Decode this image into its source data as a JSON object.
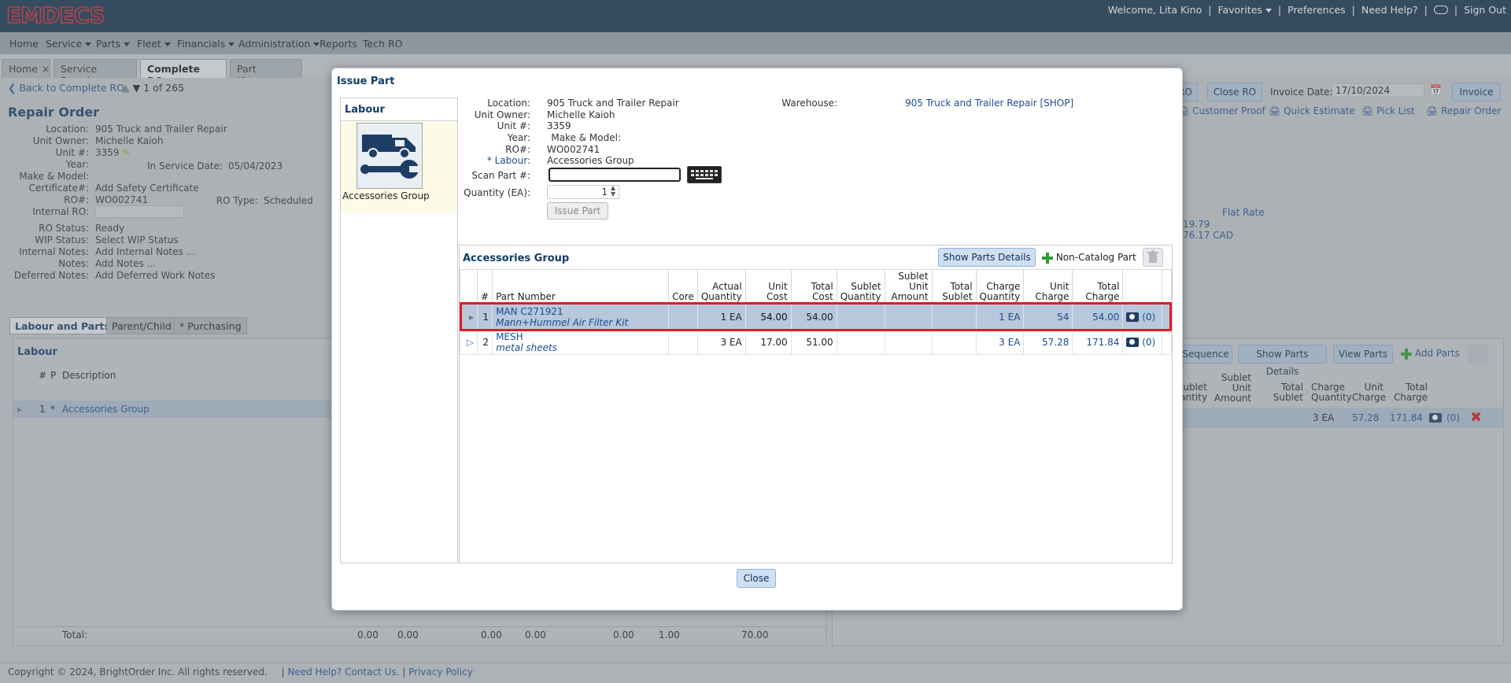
{
  "app": {
    "logo": "EMDECS"
  },
  "topbar": {
    "welcome": "Welcome, Lita Kino",
    "favorites": "Favorites",
    "preferences": "Preferences",
    "help": "Need Help?",
    "signout": "Sign Out"
  },
  "menu": [
    "Home",
    "Service",
    "Parts",
    "Fleet",
    "Financials",
    "Administration",
    "Reports",
    "Tech RO"
  ],
  "tabs": [
    "Home",
    "Service Board",
    "Complete RO",
    "Part Master"
  ],
  "background": {
    "back_link": "Back to Complete RO",
    "pager": "1  of 265",
    "page_title": "Repair Order",
    "fields": [
      {
        "label": "Location:",
        "value": "905 Truck and Trailer Repair"
      },
      {
        "label": "Unit Owner:",
        "value": "Michelle Kaioh"
      },
      {
        "label": "Unit #:",
        "value": "3359"
      },
      {
        "label": "Year:",
        "value": ""
      },
      {
        "label": "Make & Model:",
        "value": ""
      },
      {
        "label": "Certificate#:",
        "value": "Add Safety Certificate"
      },
      {
        "label": "RO#:",
        "value": "WO002741"
      },
      {
        "label": "Internal RO:",
        "value": ""
      },
      {
        "label": "RO Status:",
        "value": "Ready"
      },
      {
        "label": "WIP Status:",
        "value": "Select WIP Status"
      },
      {
        "label": "Internal Notes:",
        "value": "Add Internal Notes ..."
      },
      {
        "label": "Notes:",
        "value": "Add Notes ..."
      },
      {
        "label": "Deferred Notes:",
        "value": "Add Deferred Work Notes"
      }
    ],
    "in_service_label": "In Service Date:",
    "in_service_value": "05/04/2023",
    "ro_type_label": "RO Type:",
    "ro_type_value": "Scheduled",
    "subtabs": [
      "Labour and Parts",
      "Parent/Child",
      "* Purchasing"
    ],
    "labour_header": "Labour",
    "labour_cols": [
      "#",
      "P",
      "Description"
    ],
    "labour_row": {
      "num": "1",
      "p": "*",
      "desc": "Accessories Group"
    },
    "total_label": "Total:",
    "totals": [
      "0.00",
      "0.00",
      "0.00",
      "0.00",
      "0.00",
      "1.00",
      "70.00"
    ],
    "right_buttons": {
      "ro": "RO",
      "close_ro": "Close RO",
      "invoice_date_label": "Invoice Date:",
      "invoice_date": "17/10/2024",
      "invoice": "Invoice"
    },
    "right_links": [
      "Customer Proof",
      "Quick Estimate",
      "Pick List",
      "Repair Order"
    ],
    "flat_rate_label": "Flat Rate",
    "rate1": "19.79",
    "rate2": "76.17 CAD",
    "right_grid_buttons": [
      "Sequence",
      "Show Parts Details",
      "View Parts",
      "Add Parts"
    ],
    "right_grid_cols": [
      "ublet antity",
      "Sublet Unit Amount",
      "Total Sublet",
      "Charge Quantity",
      "Unit Charge",
      "Total Charge"
    ],
    "right_grid_row": {
      "qty": "3 EA",
      "unit": "57.28",
      "total": "171.84",
      "att": "(0)"
    },
    "copyright": "Copyright © 2024, BrightOrder Inc. All rights reserved.",
    "contact": "Need Help? Contact Us.",
    "privacy": "Privacy Policy"
  },
  "modal": {
    "title": "Issue Part",
    "labour_header": "Labour",
    "labour_item": "Accessories Group",
    "form": {
      "location_label": "Location:",
      "location": "905 Truck and Trailer Repair",
      "owner_label": "Unit Owner:",
      "owner": "Michelle Kaioh",
      "unit_label": "Unit #:",
      "unit": "3359",
      "year_label": "Year:",
      "make_label": "Make & Model:",
      "ro_label": "RO#:",
      "ro": "WO002741",
      "labour_label": "* Labour:",
      "labour": "Accessories Group",
      "scan_label": "Scan Part #:",
      "scan_value": "",
      "qty_label": "Quantity (EA):",
      "qty": "1",
      "issue_btn": "Issue Part",
      "warehouse_label": "Warehouse:",
      "warehouse": "905 Truck and Trailer Repair [SHOP]"
    },
    "grid": {
      "title": "Accessories Group",
      "show_details": "Show Parts Details",
      "non_catalog": "Non-Catalog Part",
      "columns": [
        "#",
        "Part Number",
        "Core",
        "Actual Quantity",
        "Unit Cost",
        "Total Cost",
        "Sublet Quantity",
        "Sublet Unit Amount",
        "Total Sublet",
        "Charge Quantity",
        "Unit Charge",
        "Total Charge"
      ],
      "rows": [
        {
          "num": "1",
          "part": "MAN C271921",
          "desc": "Mann+Hummel Air Filter Kit",
          "core": "",
          "actual": "1 EA",
          "unit_cost": "54.00",
          "total_cost": "54.00",
          "sub_qty": "",
          "sub_unit": "",
          "tot_sub": "",
          "charge_qty": "1 EA",
          "unit_charge": "54",
          "total_charge": "54.00",
          "att": "(0)"
        },
        {
          "num": "2",
          "part": "MESH",
          "desc": "metal sheets",
          "core": "",
          "actual": "3 EA",
          "unit_cost": "17.00",
          "total_cost": "51.00",
          "sub_qty": "",
          "sub_unit": "",
          "tot_sub": "",
          "charge_qty": "3 EA",
          "unit_charge": "57.28",
          "total_charge": "171.84",
          "att": "(0)"
        }
      ]
    },
    "close": "Close"
  },
  "colors": {
    "topbar": "#12304f",
    "logo": "#e0242d",
    "highlight": "#e01b24",
    "selected_row": "#b7c8dd"
  }
}
